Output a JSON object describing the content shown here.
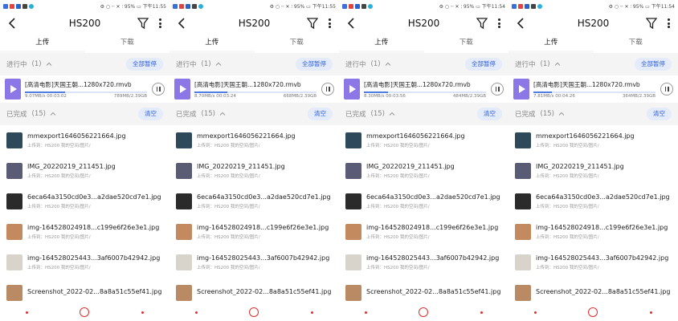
{
  "colors": {
    "accent": "#2d5fd8",
    "pill_bg": "#e4ebfb",
    "video_icon": "#8b78e6",
    "progress": "#4f7fe5",
    "nav": "#e02d2d"
  },
  "screens": [
    {
      "status": {
        "right": "⚙ ○ ┄ ✕ ⫶ 95% ▭ 下午11:55"
      },
      "header": {
        "title": "HS200",
        "back_icon": "back-arrow-icon",
        "filter_icon": "filter-icon",
        "more_icon": "more-vertical-icon"
      },
      "tabs": [
        {
          "label": "上传"
        },
        {
          "label": "下载"
        }
      ],
      "in_progress": {
        "label": "进行中",
        "count": "(1)",
        "action": "全部暂停"
      },
      "upload": {
        "name": "[高清电影]天国王朝...1280x720.rmvb",
        "speed_time": "9.07MB/s 00:03:02",
        "size": "789MB/2.39GB",
        "progress": 0.33
      },
      "completed": {
        "label": "已完成",
        "count": "(15)",
        "action": "清空"
      },
      "files": [
        {
          "name": "mmexport1646056221664.jpg",
          "sub": "上传到：HS200 我的空间/图片/",
          "thumb": "#2e4a5a"
        },
        {
          "name": "IMG_20220219_211451.jpg",
          "sub": "上传到：HS200 我的空间/图片/",
          "thumb": "#5a5c76"
        },
        {
          "name": "6eca64a3150cd0e3...a2dae520cd7e1.jpg",
          "sub": "上传到：HS200 我的空间/图片/",
          "thumb": "#2b2b2b"
        },
        {
          "name": "img-164528024918...c199e6f26e3e1.jpg",
          "sub": "上传到：HS200 我的空间/图片/",
          "thumb": "#c28a5e"
        },
        {
          "name": "img-164528025443...3af6007b42942.jpg",
          "sub": "上传到：HS200 我的空间/图片/",
          "thumb": "#d9d4cb"
        },
        {
          "name": "Screenshot_2022-02...8a8a51c55ef41.jpg",
          "sub": "",
          "thumb": "#b98a64"
        }
      ]
    },
    {
      "status": {
        "right": "⚙ ○ ┄ ✕ ⫶ 95% ▭ 下午11:55"
      },
      "header": {
        "title": "HS200",
        "back_icon": "back-arrow-icon",
        "filter_icon": "filter-icon",
        "more_icon": "more-vertical-icon"
      },
      "tabs": [
        {
          "label": "上传"
        },
        {
          "label": "下载"
        }
      ],
      "in_progress": {
        "label": "进行中",
        "count": "(1)",
        "action": "全部暂停"
      },
      "upload": {
        "name": "[高清电影]天国王朝...1280x720.rmvb",
        "speed_time": "8.70MB/s 00:03:24",
        "size": "668MB/2.39GB",
        "progress": 0.27
      },
      "completed": {
        "label": "已完成",
        "count": "(15)",
        "action": "清空"
      },
      "files": [
        {
          "name": "mmexport1646056221664.jpg",
          "sub": "上传到：HS200 我的空间/图片/",
          "thumb": "#2e4a5a"
        },
        {
          "name": "IMG_20220219_211451.jpg",
          "sub": "上传到：HS200 我的空间/图片/",
          "thumb": "#5a5c76"
        },
        {
          "name": "6eca64a3150cd0e3...a2dae520cd7e1.jpg",
          "sub": "上传到：HS200 我的空间/图片/",
          "thumb": "#2b2b2b"
        },
        {
          "name": "img-164528024918...c199e6f26e3e1.jpg",
          "sub": "上传到：HS200 我的空间/图片/",
          "thumb": "#c28a5e"
        },
        {
          "name": "img-164528025443...3af6007b42942.jpg",
          "sub": "上传到：HS200 我的空间/图片/",
          "thumb": "#d9d4cb"
        },
        {
          "name": "Screenshot_2022-02...8a8a51c55ef41.jpg",
          "sub": "",
          "thumb": "#b98a64"
        }
      ]
    },
    {
      "status": {
        "right": "⚙ ○ ┄ ✕ ⫶ 95% ▭ 下午11:54"
      },
      "header": {
        "title": "HS200",
        "back_icon": "back-arrow-icon",
        "filter_icon": "filter-icon",
        "more_icon": "more-vertical-icon"
      },
      "tabs": [
        {
          "label": "上传"
        },
        {
          "label": "下载"
        }
      ],
      "in_progress": {
        "label": "进行中",
        "count": "(1)",
        "action": "全部暂停"
      },
      "upload": {
        "name": "[高清电影]天国王朝...1280x720.rmvb",
        "speed_time": "8.30MB/s 00:03:56",
        "size": "484MB/2.39GB",
        "progress": 0.2
      },
      "completed": {
        "label": "已完成",
        "count": "(15)",
        "action": "清空"
      },
      "files": [
        {
          "name": "mmexport1646056221664.jpg",
          "sub": "上传到：HS200 我的空间/图片/",
          "thumb": "#2e4a5a"
        },
        {
          "name": "IMG_20220219_211451.jpg",
          "sub": "上传到：HS200 我的空间/图片/",
          "thumb": "#5a5c76"
        },
        {
          "name": "6eca64a3150cd0e3...a2dae520cd7e1.jpg",
          "sub": "上传到：HS200 我的空间/图片/",
          "thumb": "#2b2b2b"
        },
        {
          "name": "img-164528024918...c199e6f26e3e1.jpg",
          "sub": "上传到：HS200 我的空间/图片/",
          "thumb": "#c28a5e"
        },
        {
          "name": "img-164528025443...3af6007b42942.jpg",
          "sub": "上传到：HS200 我的空间/图片/",
          "thumb": "#d9d4cb"
        },
        {
          "name": "Screenshot_2022-02...8a8a51c55ef41.jpg",
          "sub": "",
          "thumb": "#b98a64"
        }
      ]
    },
    {
      "status": {
        "right": "⚙ ○ ┄ ✕ ⫶ 95% ▭ 下午11:54"
      },
      "header": {
        "title": "HS200",
        "back_icon": "back-arrow-icon",
        "filter_icon": "filter-icon",
        "more_icon": "more-vertical-icon"
      },
      "tabs": [
        {
          "label": "上传"
        },
        {
          "label": "下载"
        }
      ],
      "in_progress": {
        "label": "进行中",
        "count": "(1)",
        "action": "全部暂停"
      },
      "upload": {
        "name": "[高清电影]天国王朝...1280x720.rmvb",
        "speed_time": "7.81MB/s 00:04:26",
        "size": "364MB/2.39GB",
        "progress": 0.15
      },
      "completed": {
        "label": "已完成",
        "count": "(15)",
        "action": "清空"
      },
      "files": [
        {
          "name": "mmexport1646056221664.jpg",
          "sub": "上传到：HS200 我的空间/图片/",
          "thumb": "#2e4a5a"
        },
        {
          "name": "IMG_20220219_211451.jpg",
          "sub": "上传到：HS200 我的空间/图片/",
          "thumb": "#5a5c76"
        },
        {
          "name": "6eca64a3150cd0e3...a2dae520cd7e1.jpg",
          "sub": "上传到：HS200 我的空间/图片/",
          "thumb": "#2b2b2b"
        },
        {
          "name": "img-164528024918...c199e6f26e3e1.jpg",
          "sub": "上传到：HS200 我的空间/图片/",
          "thumb": "#c28a5e"
        },
        {
          "name": "img-164528025443...3af6007b42942.jpg",
          "sub": "上传到：HS200 我的空间/图片/",
          "thumb": "#d9d4cb"
        },
        {
          "name": "Screenshot_2022-02...8a8a51c55ef41.jpg",
          "sub": "",
          "thumb": "#b98a64"
        }
      ]
    }
  ]
}
